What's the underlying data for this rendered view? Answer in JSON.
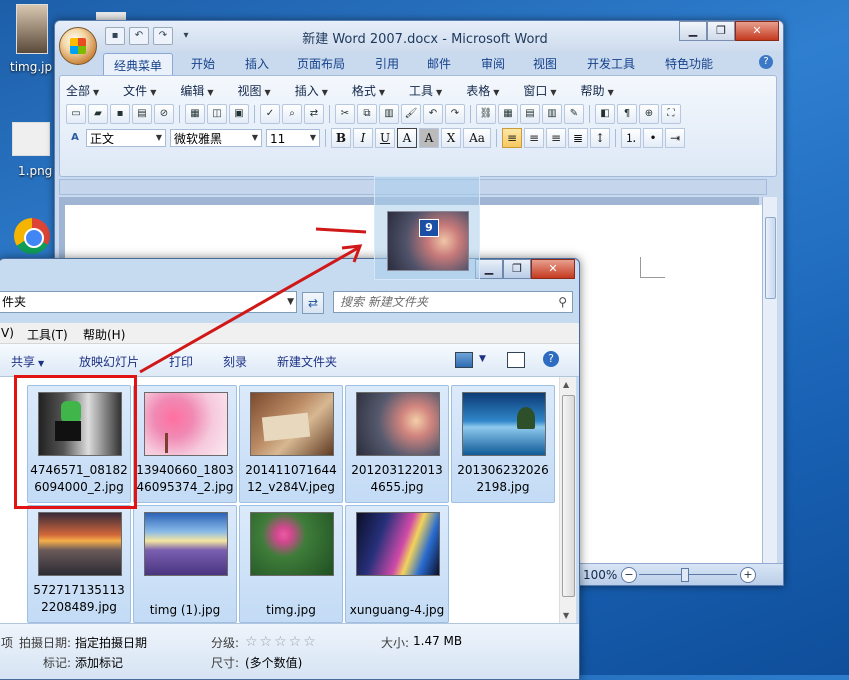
{
  "desktop": {
    "icons": [
      {
        "label": "timg.jp"
      },
      {
        "label": "1.png"
      }
    ]
  },
  "word": {
    "title": "新建 Word 2007.docx - Microsoft Word",
    "tabs": [
      "经典菜单",
      "开始",
      "插入",
      "页面布局",
      "引用",
      "邮件",
      "审阅",
      "视图",
      "开发工具",
      "特色功能"
    ],
    "menus": [
      "全部",
      "文件",
      "编辑",
      "视图",
      "插入",
      "格式",
      "工具",
      "表格",
      "窗口",
      "帮助"
    ],
    "style_value": "正文",
    "font_value": "微软雅黑",
    "size_value": "11",
    "format_buttons": [
      "B",
      "I",
      "U",
      "A",
      "A",
      "X",
      "Aa"
    ],
    "zoom": "100%"
  },
  "drag": {
    "badge_count": "9"
  },
  "explorer": {
    "address": "件夹",
    "search_placeholder": "搜索 新建文件夹",
    "menus": [
      "V)",
      "工具(T)",
      "帮助(H)"
    ],
    "commands": [
      "共享",
      "放映幻灯片",
      "打印",
      "刻录",
      "新建文件夹"
    ],
    "files": [
      {
        "name": "4746571_081826094000_2.jpg",
        "selected": true
      },
      {
        "name": "13940660_180346095374_2.jpg",
        "selected": true
      },
      {
        "name": "20141107164412_v284V.jpeg",
        "selected": true
      },
      {
        "name": "2012031220134655.jpg",
        "selected": true
      },
      {
        "name": "2013062320262198.jpg",
        "selected": true
      },
      {
        "name": "5727171351132208489.jpg",
        "selected": true
      },
      {
        "name": "timg (1).jpg",
        "selected": true
      },
      {
        "name": "timg.jpg",
        "selected": true
      },
      {
        "name": "xunguang-4.jpg",
        "selected": true
      }
    ],
    "details": {
      "items_label": "项",
      "date_label": "拍摄日期:",
      "date_value": "指定拍摄日期",
      "rating_label": "分级:",
      "size_label": "大小:",
      "size_value": "1.47 MB",
      "tags_label": "标记:",
      "tags_value": "添加标记",
      "dims_label": "尺寸:",
      "dims_value": "(多个数值)"
    }
  },
  "colors": {
    "highlight": "#e11414",
    "arrow": "#d01818",
    "desktop": "#2f7fd0"
  }
}
